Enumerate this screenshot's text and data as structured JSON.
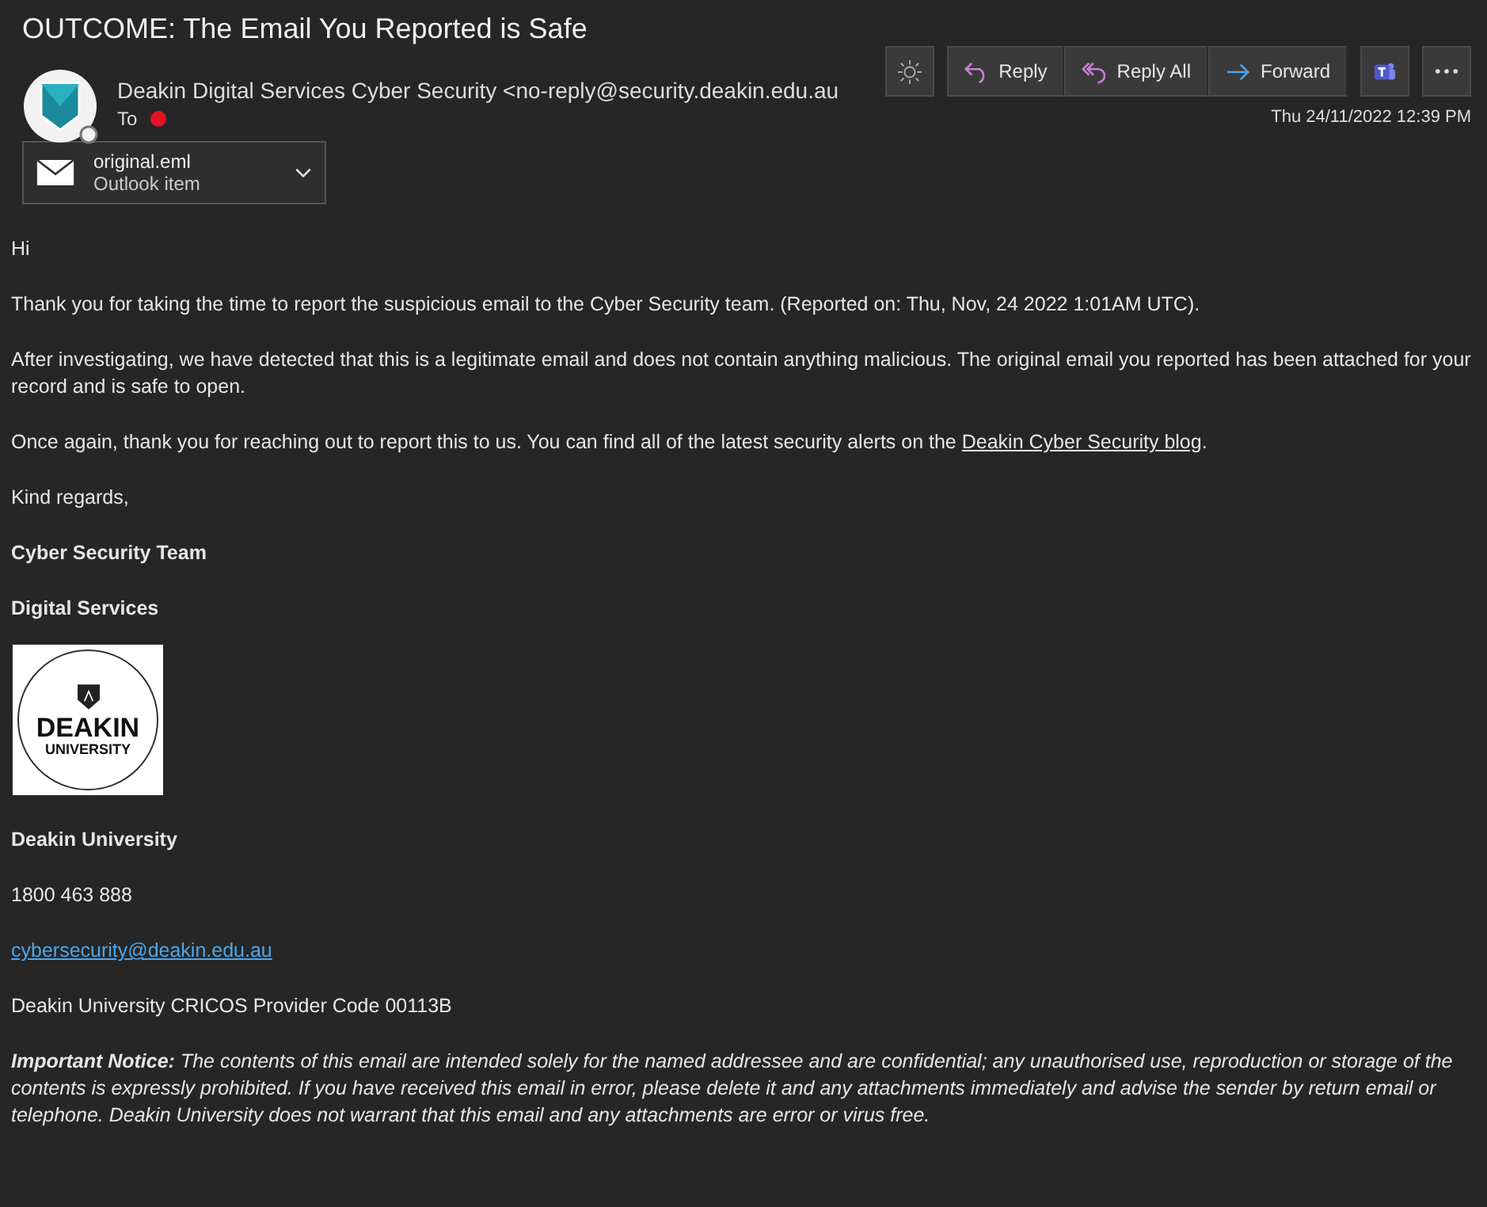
{
  "subject": "OUTCOME: The Email You Reported is Safe",
  "sender": {
    "name": "Deakin Digital Services Cyber Security",
    "address": "<no-reply@security.deakin.edu.au"
  },
  "to_label": "To",
  "actions": [
    {
      "label": "Reply",
      "kind": "reply"
    },
    {
      "label": "Reply All",
      "kind": "reply-all"
    },
    {
      "label": "Forward",
      "kind": "forward"
    }
  ],
  "date": "Thu 24/11/2022 12:39 PM",
  "attachment": {
    "name": "original.eml",
    "type": "Outlook item"
  },
  "body": {
    "greeting": "Hi",
    "paragraphs": [
      {
        "text": "Thank you for taking the time to report the suspicious email to the Cyber Security team. (Reported on: Thu, Nov, 24 2022 1:01AM UTC)."
      },
      {
        "text": "After investigating, we have detected that this is a legitimate email and does not contain anything malicious. The original email you reported has been attached for your record and is safe to open."
      },
      {
        "text": "Once again, thank you for reaching out to report this to us. You can find all of the latest security alerts on the ",
        "link": "Deakin Cyber Security blog",
        "after": "."
      },
      {
        "text": "Kind regards,"
      }
    ],
    "signature": [
      "Cyber Security Team",
      "Digital Services"
    ],
    "logo": {
      "line_1": "DEAKIN",
      "line_2": "UNIVERSITY"
    },
    "organisation": "Deakin University",
    "phone": "1800 463 888",
    "email": "cybersecurity@deakin.edu.au",
    "cricos": "Deakin University CRICOS Provider Code 00113B",
    "notice": "**Important Notice:** The contents of this email are intended solely for the named addressee and are confidential; any unauthorised use, reproduction or storage of the contents is expressly prohibited. If you have received this email in error, please delete it and any attachments immediately and advise the sender by return email or telephone. Deakin University does not warrant that this email and any attachments are error or virus free."
  }
}
